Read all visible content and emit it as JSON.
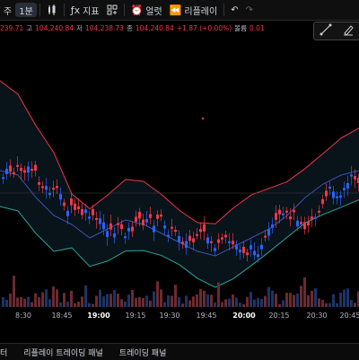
{
  "toolbar": {
    "items": [
      {
        "label": "주",
        "name": "interval-week",
        "icon": ""
      },
      {
        "label": "1분",
        "name": "interval-1m",
        "icon": ""
      },
      {
        "label": "",
        "name": "candle-type",
        "icon": "candles-icon"
      },
      {
        "label": "지표",
        "name": "indicators",
        "icon": "indicators-icon"
      },
      {
        "label": "",
        "name": "layout",
        "icon": "layout-icon"
      },
      {
        "label": "얼럿",
        "name": "alert",
        "icon": "alert-clock-icon"
      },
      {
        "label": "리플레이",
        "name": "replay",
        "icon": "rewind-icon"
      },
      {
        "label": "",
        "name": "undo",
        "icon": "undo-icon"
      },
      {
        "label": "",
        "name": "redo",
        "icon": "redo-icon"
      }
    ]
  },
  "ohlc": {
    "open_val": "239.71",
    "high_label": "고",
    "high_val": "104,240.84",
    "low_label": "저",
    "low_val": "104,238.73",
    "close_label": "종",
    "close_val": "104,240.84",
    "change": "+1.87 (+0.00%)",
    "vol_label": "볼륨",
    "vol_val": "0.01"
  },
  "time_axis": [
    {
      "label": "8:30",
      "bold": false
    },
    {
      "label": "18:45",
      "bold": false
    },
    {
      "label": "19:00",
      "bold": true
    },
    {
      "label": "19:15",
      "bold": false
    },
    {
      "label": "19:30",
      "bold": false
    },
    {
      "label": "19:45",
      "bold": false
    },
    {
      "label": "20:00",
      "bold": true
    },
    {
      "label": "20:15",
      "bold": false
    },
    {
      "label": "20:30",
      "bold": false
    },
    {
      "label": "20:45",
      "bold": false
    }
  ],
  "bottom_tabs": [
    {
      "label": "터"
    },
    {
      "label": "리플레이 트레이딩 패널"
    },
    {
      "label": "트레이딩 패널"
    }
  ],
  "colors": {
    "up": "#f23645",
    "down": "#2962ff",
    "band": "#f23645",
    "lower": "#26a69a",
    "mid": "#3f51b5"
  }
}
